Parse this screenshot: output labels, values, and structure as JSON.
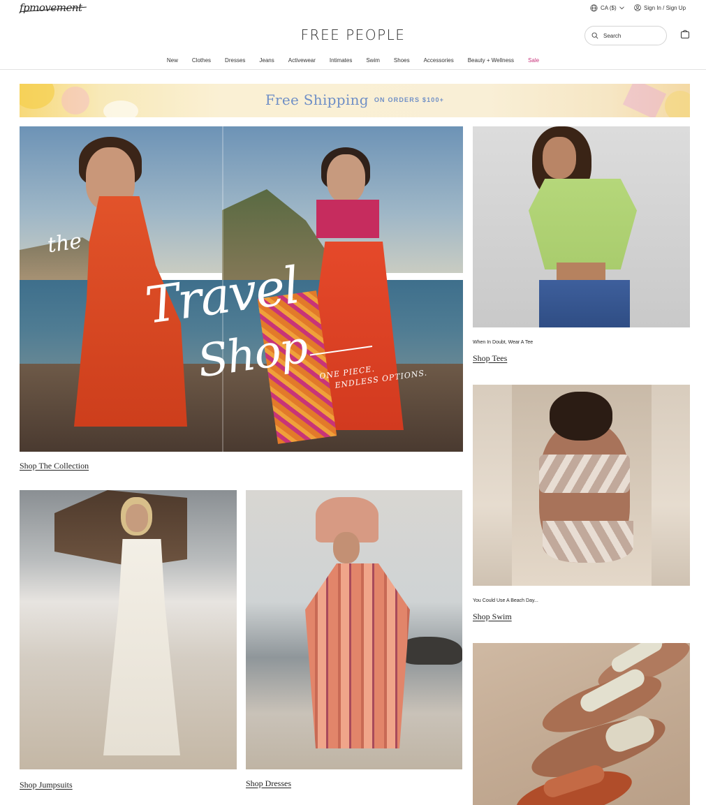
{
  "header": {
    "fm_logo": "fpmovement",
    "region_label": "CA ($)",
    "signin_label": "Sign In / Sign Up",
    "brand": "FREE PEOPLE",
    "search_placeholder": "Search",
    "nav": [
      "New",
      "Clothes",
      "Dresses",
      "Jeans",
      "Activewear",
      "Intimates",
      "Swim",
      "Shoes",
      "Accessories",
      "Beauty + Wellness",
      "Sale"
    ]
  },
  "promo": {
    "big": "Free Shipping",
    "small": "ON ORDERS $100+"
  },
  "hero": {
    "script_the": "the",
    "script_travel": "Travel",
    "script_shop": "Shop",
    "script_tagline_1": "ONE PIECE.",
    "script_tagline_2": "ENDLESS OPTIONS.",
    "link": "Shop The Collection"
  },
  "tiles": {
    "tees": {
      "caption": "When In Doubt, Wear A Tee",
      "link": "Shop Tees"
    },
    "swim": {
      "caption": "You Could Use A Beach Day...",
      "link": "Shop Swim"
    },
    "jumpsuits": {
      "link": "Shop Jumpsuits"
    },
    "dresses": {
      "link": "Shop Dresses"
    }
  },
  "colors": {
    "sale": "#c8327a",
    "promo_text": "#6f8fc6"
  }
}
